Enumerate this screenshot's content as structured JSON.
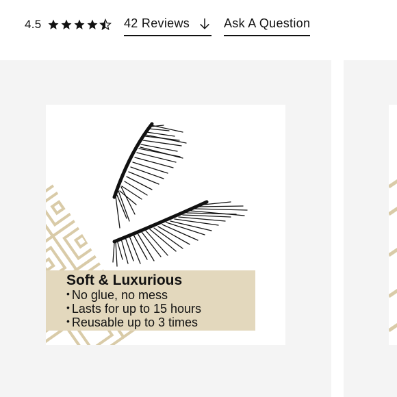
{
  "rating": {
    "value": "4.5",
    "stars_filled": 4.5,
    "stars_total": 5
  },
  "reviews_link": {
    "label": "42 Reviews"
  },
  "ask_link": {
    "label": "Ask A Question"
  },
  "gallery": {
    "caption": {
      "title": "Soft & Luxurious",
      "bullets": [
        "No glue, no mess",
        "Lasts for up to 15 hours",
        "Reusable up to 3 times"
      ]
    },
    "icons": {
      "star": "star-icon",
      "arrow": "arrow-down-icon"
    },
    "colors": {
      "card_bg": "#f4f4f4",
      "caption_band": "#e3d8bd",
      "pattern": "#d9cba8",
      "text": "#111111"
    }
  }
}
